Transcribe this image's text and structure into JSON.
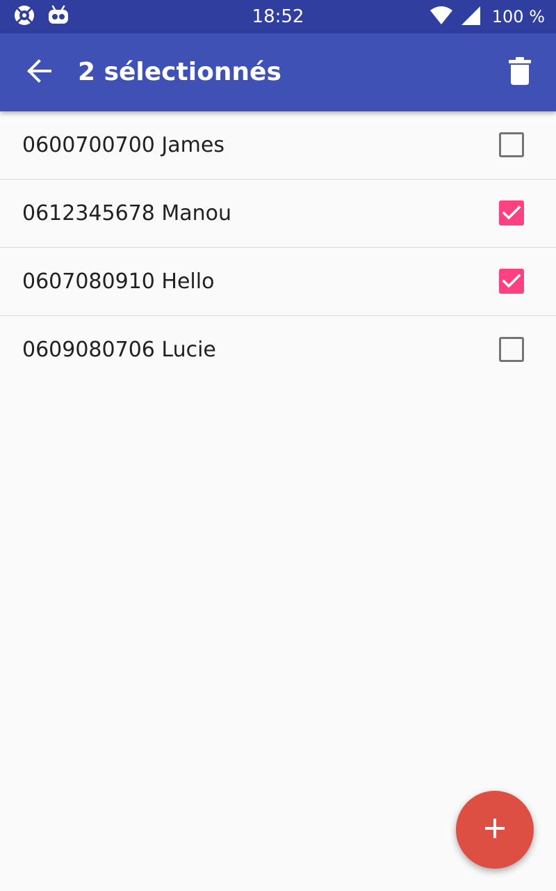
{
  "status_bar": {
    "time": "18:52",
    "battery": "100 %",
    "icons": [
      "lab-icon",
      "android-icon",
      "wifi-icon",
      "signal-icon"
    ]
  },
  "toolbar": {
    "title": "2 sélectionnés",
    "back_icon": "arrow-back-icon",
    "delete_icon": "trash-icon"
  },
  "contacts": [
    {
      "label": "0600700700 James",
      "checked": false
    },
    {
      "label": "0612345678 Manou",
      "checked": true
    },
    {
      "label": "0607080910 Hello",
      "checked": true
    },
    {
      "label": "0609080706 Lucie",
      "checked": false
    }
  ],
  "fab": {
    "icon": "plus-icon"
  },
  "colors": {
    "status_bar": "#303F9F",
    "toolbar": "#3F51B5",
    "checkbox_checked": "#FF4081",
    "fab": "#DD4F43",
    "background": "#FAFAFA"
  }
}
